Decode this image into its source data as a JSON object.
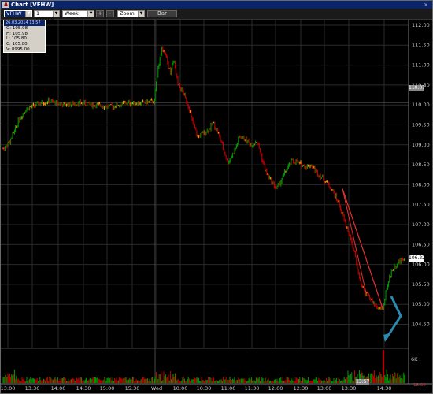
{
  "window": {
    "title": "Chart [VFHW]",
    "close_glyph": "×"
  },
  "toolbar": {
    "symbol": "VFHW",
    "interval": "1 minute",
    "range": "Week",
    "plus_label": "+",
    "minus_label": "-",
    "zoom_label": "Zoom",
    "bar_label": "Bar"
  },
  "data_window": {
    "header": "26.03.2014 13:57",
    "open": "O:  105.98",
    "high": "H:  105.98",
    "low": "L:  105.80",
    "close": "C:  105.80",
    "volume": "V:  8995.00"
  },
  "price_axis": {
    "labels": [
      "112.00",
      "111.50",
      "111.00",
      "110.50",
      "110.00",
      "109.50",
      "109.00",
      "108.50",
      "108.00",
      "107.50",
      "107.00",
      "106.50",
      "106.00",
      "105.50",
      "105.00",
      "104.50"
    ],
    "prior_tag": "110.07",
    "current_tag": "106.22",
    "volume_label": "6K"
  },
  "time_axis": {
    "labels": [
      "13:00",
      "13:30",
      "14:00",
      "14:30",
      "15:00",
      "15:30",
      "Wed",
      "10:00",
      "10:30",
      "11:00",
      "11:30",
      "12:00",
      "12:30",
      "13:00",
      "13:30",
      "14:30"
    ],
    "cursor_tag": "13:57",
    "corner_tag": "18:00"
  },
  "colors": {
    "up_bar": "#00a000",
    "down_bar": "#d00000",
    "neutral_bar": "#ffa500",
    "trend_line": "#e83030",
    "annotation_arrow": "#2a8ab0",
    "grid": "#2a2a2a"
  }
}
